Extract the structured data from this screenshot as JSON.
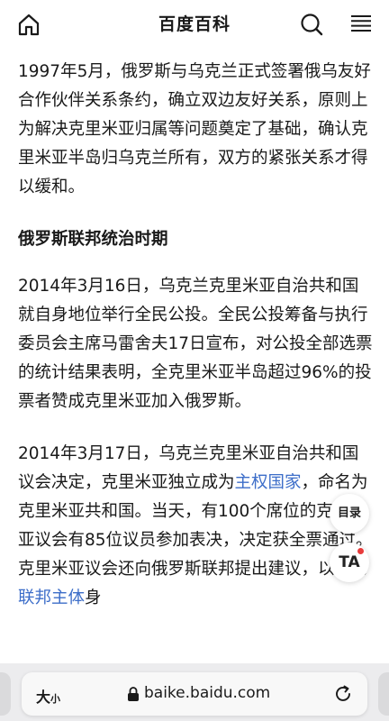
{
  "header": {
    "title": "百度百科",
    "icons": {
      "home": "home-icon",
      "search": "search-icon",
      "menu": "menu-icon"
    }
  },
  "article": {
    "para1": "1997年5月，俄罗斯与乌克兰正式签署俄乌友好合作伙伴关系条约，确立双边友好关系，原则上为解决克里米亚归属等问题奠定了基础，确认克里米亚半岛归乌克兰所有，双方的紧张关系才得以缓和。",
    "section_title": "俄罗斯联邦统治时期",
    "para2": "2014年3月16日，乌克兰克里米亚自治共和国就自身地位举行全民公投。全民公投筹备与执行委员会主席马雷舍夫17日宣布，对公投全部选票的统计结果表明，全克里米亚半岛超过96%的投票者赞成克里米亚加入俄罗斯。",
    "para3": {
      "part1": "2014年3月17日，乌克兰克里米亚自治共和国议会决定，克里米亚独立成为",
      "link1": "主权国家",
      "part2": "，命名为克里米亚共和国。当天，有100个席位的克里米亚议会有85位议员参加表决，决定获全票通过。克里米亚议会还向俄罗斯联邦提出建议，以新的",
      "link2": "联邦主体",
      "part3": "身"
    }
  },
  "floating": {
    "toc_label": "目录",
    "ta_label": "TA"
  },
  "browser": {
    "text_size_big": "大",
    "text_size_small": "小",
    "url": "baike.baidu.com",
    "colors": {
      "link": "#3d6ec9",
      "badge": "#e83b3b"
    }
  }
}
